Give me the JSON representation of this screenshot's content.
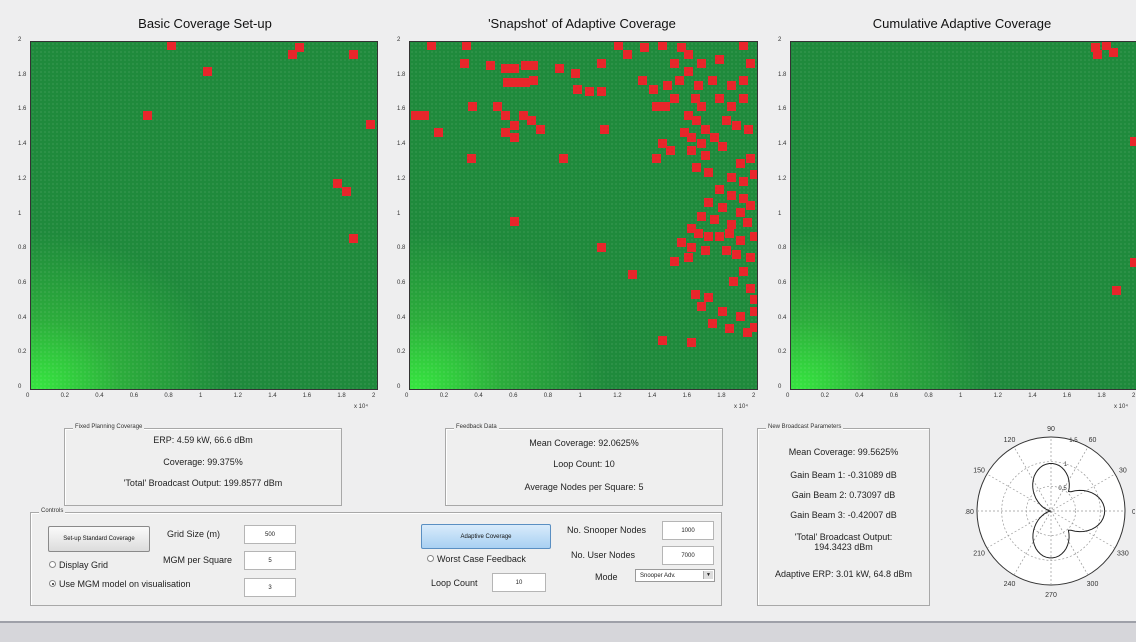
{
  "plots": [
    {
      "title": "Basic Coverage Set-up"
    },
    {
      "title": "'Snapshot' of Adaptive Coverage"
    },
    {
      "title": "Cumulative Adaptive Coverage"
    }
  ],
  "axis": {
    "ticks": [
      "0",
      "0.2",
      "0.4",
      "0.6",
      "0.8",
      "1",
      "1.2",
      "1.4",
      "1.6",
      "1.8",
      "2"
    ],
    "exponent": "x 10⁴",
    "range": [
      0,
      2
    ]
  },
  "red_squares": [
    [
      [
        0.81,
        1.98
      ],
      [
        1.02,
        1.83
      ],
      [
        1.51,
        1.93
      ],
      [
        1.55,
        1.97
      ],
      [
        1.86,
        1.93
      ],
      [
        0.67,
        1.58
      ],
      [
        1.96,
        1.53
      ],
      [
        1.77,
        1.19
      ],
      [
        1.82,
        1.14
      ],
      [
        1.86,
        0.87
      ]
    ],
    [
      [
        0.12,
        1.98
      ],
      [
        0.32,
        1.98
      ],
      [
        0.31,
        1.88
      ],
      [
        0.46,
        1.87
      ],
      [
        0.55,
        1.85
      ],
      [
        0.6,
        1.85
      ],
      [
        0.66,
        1.87
      ],
      [
        0.71,
        1.87
      ],
      [
        0.56,
        1.77
      ],
      [
        0.61,
        1.77
      ],
      [
        0.66,
        1.77
      ],
      [
        0.71,
        1.78
      ],
      [
        0.86,
        1.85
      ],
      [
        0.95,
        1.82
      ],
      [
        1.1,
        1.88
      ],
      [
        1.2,
        1.98
      ],
      [
        1.25,
        1.93
      ],
      [
        1.35,
        1.97
      ],
      [
        1.45,
        1.98
      ],
      [
        1.56,
        1.97
      ],
      [
        1.6,
        1.93
      ],
      [
        1.52,
        1.88
      ],
      [
        1.6,
        1.83
      ],
      [
        1.68,
        1.88
      ],
      [
        1.78,
        1.9
      ],
      [
        1.92,
        1.98
      ],
      [
        1.96,
        1.88
      ],
      [
        0.03,
        1.58
      ],
      [
        0.08,
        1.58
      ],
      [
        0.36,
        1.63
      ],
      [
        0.5,
        1.63
      ],
      [
        0.55,
        1.58
      ],
      [
        0.6,
        1.52
      ],
      [
        0.65,
        1.58
      ],
      [
        0.7,
        1.55
      ],
      [
        0.75,
        1.5
      ],
      [
        0.55,
        1.48
      ],
      [
        0.6,
        1.45
      ],
      [
        0.16,
        1.48
      ],
      [
        0.96,
        1.73
      ],
      [
        1.03,
        1.72
      ],
      [
        1.1,
        1.72
      ],
      [
        1.34,
        1.78
      ],
      [
        1.4,
        1.73
      ],
      [
        1.48,
        1.75
      ],
      [
        1.55,
        1.78
      ],
      [
        1.66,
        1.75
      ],
      [
        1.74,
        1.78
      ],
      [
        1.85,
        1.75
      ],
      [
        1.92,
        1.78
      ],
      [
        1.42,
        1.63
      ],
      [
        1.47,
        1.63
      ],
      [
        1.52,
        1.68
      ],
      [
        1.64,
        1.68
      ],
      [
        1.68,
        1.63
      ],
      [
        1.78,
        1.68
      ],
      [
        1.85,
        1.63
      ],
      [
        1.92,
        1.68
      ],
      [
        1.6,
        1.58
      ],
      [
        1.65,
        1.55
      ],
      [
        1.7,
        1.5
      ],
      [
        1.58,
        1.48
      ],
      [
        1.62,
        1.45
      ],
      [
        1.68,
        1.42
      ],
      [
        1.75,
        1.45
      ],
      [
        1.82,
        1.55
      ],
      [
        1.88,
        1.52
      ],
      [
        1.95,
        1.5
      ],
      [
        1.12,
        1.5
      ],
      [
        1.45,
        1.42
      ],
      [
        1.5,
        1.38
      ],
      [
        1.42,
        1.33
      ],
      [
        1.62,
        1.38
      ],
      [
        1.7,
        1.35
      ],
      [
        1.8,
        1.4
      ],
      [
        0.35,
        1.33
      ],
      [
        0.88,
        1.33
      ],
      [
        1.65,
        1.28
      ],
      [
        1.72,
        1.25
      ],
      [
        1.9,
        1.3
      ],
      [
        1.96,
        1.33
      ],
      [
        1.85,
        1.22
      ],
      [
        1.92,
        1.2
      ],
      [
        1.98,
        1.24
      ],
      [
        1.78,
        1.15
      ],
      [
        1.85,
        1.12
      ],
      [
        1.92,
        1.1
      ],
      [
        1.72,
        1.08
      ],
      [
        1.8,
        1.05
      ],
      [
        1.9,
        1.02
      ],
      [
        1.96,
        1.06
      ],
      [
        1.68,
        1.0
      ],
      [
        1.75,
        0.98
      ],
      [
        1.85,
        0.95
      ],
      [
        1.94,
        0.96
      ],
      [
        1.62,
        0.93
      ],
      [
        1.66,
        0.9
      ],
      [
        1.72,
        0.88
      ],
      [
        1.78,
        0.88
      ],
      [
        1.84,
        0.9
      ],
      [
        1.9,
        0.86
      ],
      [
        1.98,
        0.88
      ],
      [
        1.56,
        0.85
      ],
      [
        1.62,
        0.82
      ],
      [
        1.7,
        0.8
      ],
      [
        1.82,
        0.8
      ],
      [
        1.88,
        0.78
      ],
      [
        1.96,
        0.76
      ],
      [
        1.52,
        0.74
      ],
      [
        1.6,
        0.76
      ],
      [
        1.92,
        0.68
      ],
      [
        0.6,
        0.97
      ],
      [
        1.1,
        0.82
      ],
      [
        1.28,
        0.66
      ],
      [
        1.86,
        0.62
      ],
      [
        1.96,
        0.58
      ],
      [
        1.64,
        0.55
      ],
      [
        1.72,
        0.53
      ],
      [
        1.98,
        0.52
      ],
      [
        1.68,
        0.48
      ],
      [
        1.8,
        0.45
      ],
      [
        1.9,
        0.42
      ],
      [
        1.98,
        0.45
      ],
      [
        1.74,
        0.38
      ],
      [
        1.84,
        0.35
      ],
      [
        1.94,
        0.33
      ],
      [
        1.98,
        0.36
      ],
      [
        1.45,
        0.28
      ],
      [
        1.62,
        0.27
      ]
    ],
    [
      [
        1.76,
        1.97
      ],
      [
        1.82,
        1.98
      ],
      [
        1.77,
        1.93
      ],
      [
        1.86,
        1.94
      ],
      [
        1.98,
        1.43
      ],
      [
        1.98,
        0.73
      ],
      [
        1.88,
        0.57
      ]
    ]
  ],
  "panels": {
    "fixed": {
      "title": "Fixed Planning Coverage",
      "erp": "ERP: 4.59 kW, 66.6 dBm",
      "coverage": "Coverage: 99.375%",
      "total": "'Total' Broadcast Output: 199.8577 dBm"
    },
    "feedback": {
      "title": "Feedback Data",
      "mean": "Mean Coverage: 92.0625%",
      "loop": "Loop Count: 10",
      "avg": "Average Nodes per Square: 5"
    },
    "newparams": {
      "title": "New Broadcast Parameters",
      "mean": "Mean Coverage: 99.5625%",
      "gain1": "Gain Beam 1: -0.31089 dB",
      "gain2": "Gain Beam 2: 0.73097 dB",
      "gain3": "Gain Beam 3: -0.42007 dB",
      "total1": "'Total' Broadcast Output:",
      "total2": "194.3423 dBm",
      "erp": "Adaptive ERP: 3.01 kW, 64.8 dBm"
    }
  },
  "controls": {
    "title": "Controls",
    "setup_button": "Set-up Standard Coverage",
    "display_grid": "Display Grid",
    "use_mgm": "Use MGM model on visualisation",
    "grid_size_label": "Grid Size (m)",
    "grid_size_value": "500",
    "mgm_label": "MGM per Square",
    "mgm_value": "5",
    "third_value": "3",
    "adaptive_button": "Adaptive Coverage",
    "worst_case": "Worst Case Feedback",
    "loop_label": "Loop Count",
    "loop_value": "10",
    "snooper_label": "No. Snooper Nodes",
    "snooper_value": "1000",
    "user_label": "No. User Nodes",
    "user_value": "7000",
    "mode_label": "Mode",
    "mode_value": "Snooper Adv."
  },
  "polar": {
    "angles": [
      "90",
      "60",
      "30",
      "0",
      "330",
      "300",
      "270",
      "240",
      "210",
      "180",
      "150",
      "120"
    ],
    "radii": [
      "0.5",
      "1",
      "1.5"
    ],
    "gains": [
      -0.31089,
      0.73097,
      -0.42007
    ]
  },
  "colors": {
    "coverage": "#1f8a3c",
    "hole": "#e8262b",
    "button_blue": "#a9d0f2"
  }
}
